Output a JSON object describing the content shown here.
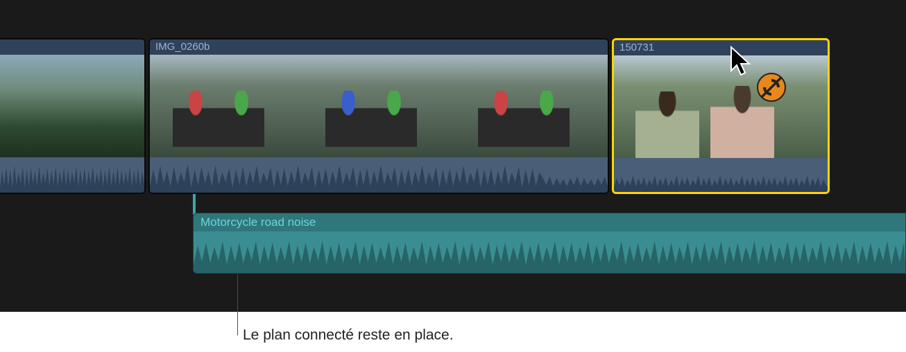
{
  "clips": [
    {
      "name": "",
      "selected": false
    },
    {
      "name": "IMG_0260b",
      "selected": false
    },
    {
      "name": "150731",
      "selected": true
    }
  ],
  "connected_audio": {
    "name": "Motorcycle road noise"
  },
  "cursor": {
    "badge_icon": "override-connection-disabled-icon"
  },
  "callout": {
    "text": "Le plan connecté reste en place."
  }
}
